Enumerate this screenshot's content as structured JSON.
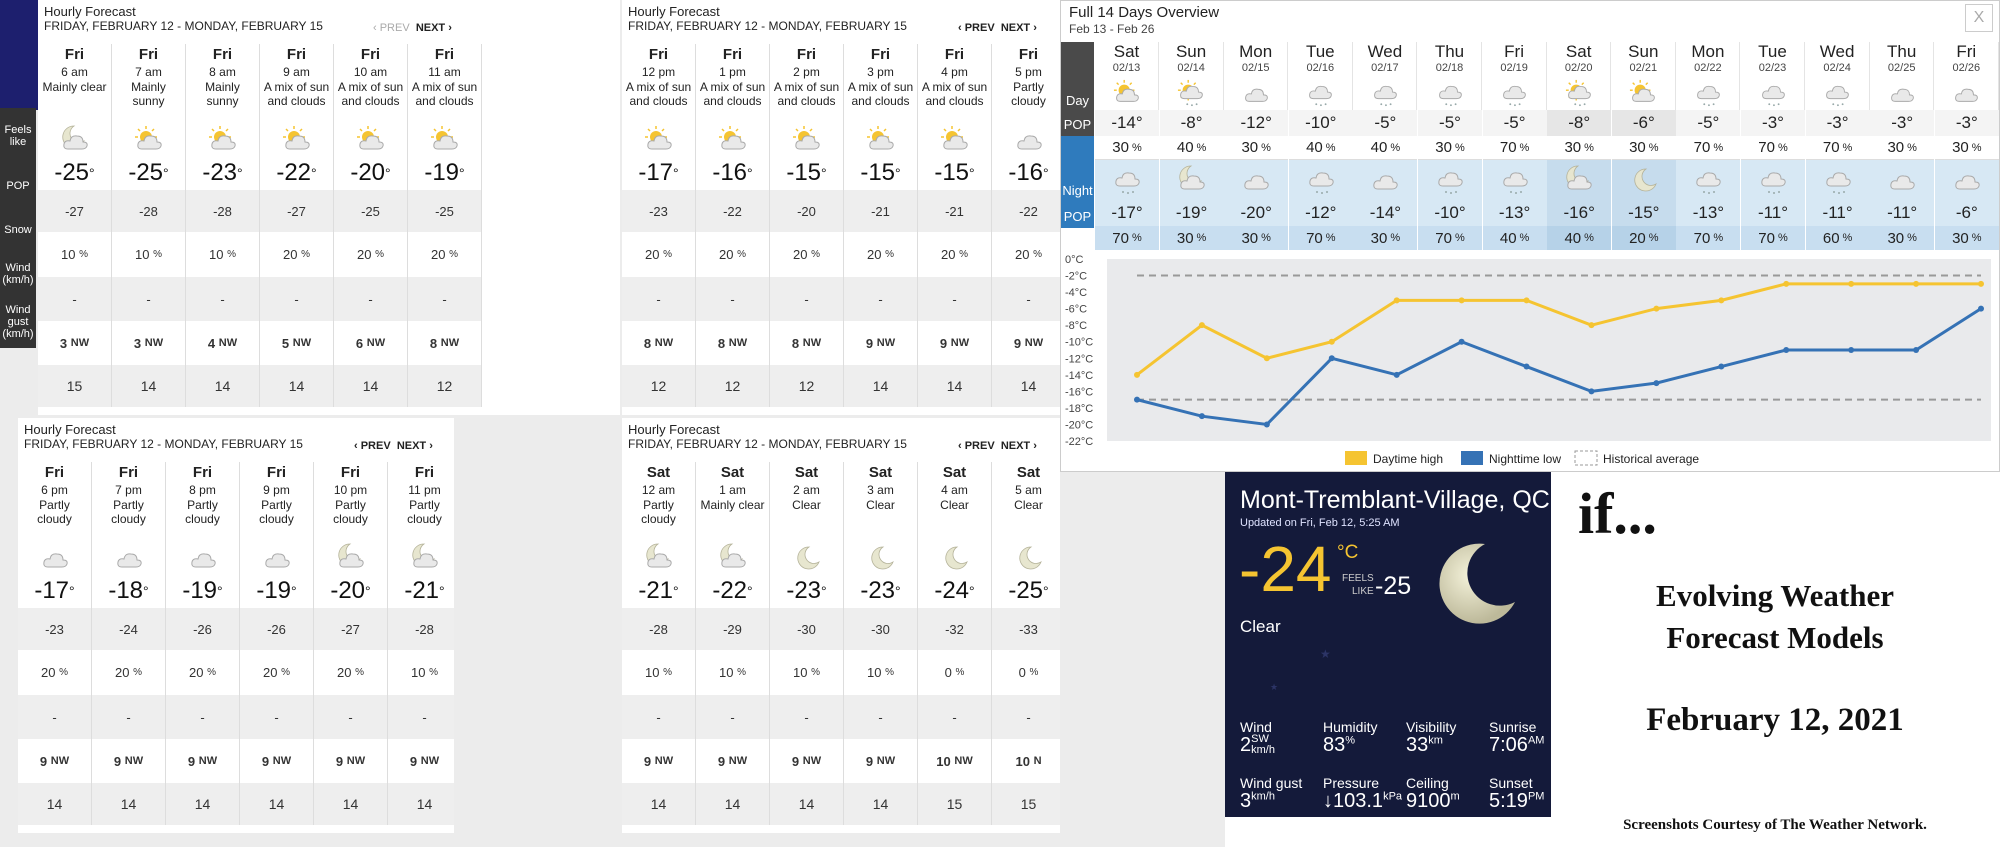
{
  "panel_a": {
    "title": "Hourly Forecast",
    "range": "FRIDAY, FEBRUARY 12 - MONDAY, FEBRUARY 15",
    "prev": "‹ PREV",
    "next": "NEXT ›",
    "row_labels": {
      "feels": "Feels like",
      "pop": "POP",
      "snow": "Snow",
      "wind": "Wind (km/h)",
      "gust": "Wind gust (km/h)"
    },
    "hours": [
      {
        "day": "Fri",
        "time": "6 am",
        "cond": "Mainly clear",
        "icon": "moon-cloud-icon",
        "temp": "-25",
        "feels": "-27",
        "pop": "10",
        "snow": "-",
        "wind": "3",
        "dir": "NW",
        "gust": "15"
      },
      {
        "day": "Fri",
        "time": "7 am",
        "cond": "Mainly sunny",
        "icon": "sun-cloud-icon",
        "temp": "-25",
        "feels": "-28",
        "pop": "10",
        "snow": "-",
        "wind": "3",
        "dir": "NW",
        "gust": "14"
      },
      {
        "day": "Fri",
        "time": "8 am",
        "cond": "Mainly sunny",
        "icon": "sun-cloud-icon",
        "temp": "-23",
        "feels": "-28",
        "pop": "10",
        "snow": "-",
        "wind": "4",
        "dir": "NW",
        "gust": "14"
      },
      {
        "day": "Fri",
        "time": "9 am",
        "cond": "A mix of sun and clouds",
        "icon": "sun-cloud-icon",
        "temp": "-22",
        "feels": "-27",
        "pop": "20",
        "snow": "-",
        "wind": "5",
        "dir": "NW",
        "gust": "14"
      },
      {
        "day": "Fri",
        "time": "10 am",
        "cond": "A mix of sun and clouds",
        "icon": "sun-cloud-icon",
        "temp": "-20",
        "feels": "-25",
        "pop": "20",
        "snow": "-",
        "wind": "6",
        "dir": "NW",
        "gust": "14"
      },
      {
        "day": "Fri",
        "time": "11 am",
        "cond": "A mix of sun and clouds",
        "icon": "sun-cloud-icon",
        "temp": "-19",
        "feels": "-25",
        "pop": "20",
        "snow": "-",
        "wind": "8",
        "dir": "NW",
        "gust": "12"
      }
    ]
  },
  "panel_b": {
    "title": "Hourly Forecast",
    "range": "FRIDAY, FEBRUARY 12 - MONDAY, FEBRUARY 15",
    "prev": "‹ PREV",
    "next": "NEXT ›",
    "hours": [
      {
        "day": "Fri",
        "time": "12 pm",
        "cond": "A mix of sun and clouds",
        "icon": "sun-cloud-icon",
        "temp": "-17",
        "feels": "-23",
        "pop": "20",
        "snow": "-",
        "wind": "8",
        "dir": "NW",
        "gust": "12"
      },
      {
        "day": "Fri",
        "time": "1 pm",
        "cond": "A mix of sun and clouds",
        "icon": "sun-cloud-icon",
        "temp": "-16",
        "feels": "-22",
        "pop": "20",
        "snow": "-",
        "wind": "8",
        "dir": "NW",
        "gust": "12"
      },
      {
        "day": "Fri",
        "time": "2 pm",
        "cond": "A mix of sun and clouds",
        "icon": "sun-cloud-icon",
        "temp": "-15",
        "feels": "-20",
        "pop": "20",
        "snow": "-",
        "wind": "8",
        "dir": "NW",
        "gust": "12"
      },
      {
        "day": "Fri",
        "time": "3 pm",
        "cond": "A mix of sun and clouds",
        "icon": "sun-cloud-icon",
        "temp": "-15",
        "feels": "-21",
        "pop": "20",
        "snow": "-",
        "wind": "9",
        "dir": "NW",
        "gust": "14"
      },
      {
        "day": "Fri",
        "time": "4 pm",
        "cond": "A mix of sun and clouds",
        "icon": "sun-cloud-icon",
        "temp": "-15",
        "feels": "-21",
        "pop": "20",
        "snow": "-",
        "wind": "9",
        "dir": "NW",
        "gust": "14"
      },
      {
        "day": "Fri",
        "time": "5 pm",
        "cond": "Partly cloudy",
        "icon": "cloud-icon",
        "temp": "-16",
        "feels": "-22",
        "pop": "20",
        "snow": "-",
        "wind": "9",
        "dir": "NW",
        "gust": "14"
      }
    ]
  },
  "panel_c": {
    "title": "Hourly Forecast",
    "range": "FRIDAY, FEBRUARY 12 - MONDAY, FEBRUARY 15",
    "prev": "‹ PREV",
    "next": "NEXT ›",
    "hours": [
      {
        "day": "Fri",
        "time": "6 pm",
        "cond": "Partly cloudy",
        "icon": "cloud-icon",
        "temp": "-17",
        "feels": "-23",
        "pop": "20",
        "snow": "-",
        "wind": "9",
        "dir": "NW",
        "gust": "14"
      },
      {
        "day": "Fri",
        "time": "7 pm",
        "cond": "Partly cloudy",
        "icon": "cloud-icon",
        "temp": "-18",
        "feels": "-24",
        "pop": "20",
        "snow": "-",
        "wind": "9",
        "dir": "NW",
        "gust": "14"
      },
      {
        "day": "Fri",
        "time": "8 pm",
        "cond": "Partly cloudy",
        "icon": "cloud-icon",
        "temp": "-19",
        "feels": "-26",
        "pop": "20",
        "snow": "-",
        "wind": "9",
        "dir": "NW",
        "gust": "14"
      },
      {
        "day": "Fri",
        "time": "9 pm",
        "cond": "Partly cloudy",
        "icon": "cloud-icon",
        "temp": "-19",
        "feels": "-26",
        "pop": "20",
        "snow": "-",
        "wind": "9",
        "dir": "NW",
        "gust": "14"
      },
      {
        "day": "Fri",
        "time": "10 pm",
        "cond": "Partly cloudy",
        "icon": "moon-cloud-icon",
        "temp": "-20",
        "feels": "-27",
        "pop": "20",
        "snow": "-",
        "wind": "9",
        "dir": "NW",
        "gust": "14"
      },
      {
        "day": "Fri",
        "time": "11 pm",
        "cond": "Partly cloudy",
        "icon": "moon-cloud-icon",
        "temp": "-21",
        "feels": "-28",
        "pop": "10",
        "snow": "-",
        "wind": "9",
        "dir": "NW",
        "gust": "14"
      }
    ]
  },
  "panel_d": {
    "title": "Hourly Forecast",
    "range": "FRIDAY, FEBRUARY 12 - MONDAY, FEBRUARY 15",
    "prev": "‹ PREV",
    "next": "NEXT ›",
    "hours": [
      {
        "day": "Sat",
        "time": "12 am",
        "cond": "Partly cloudy",
        "icon": "moon-cloud-icon",
        "temp": "-21",
        "feels": "-28",
        "pop": "10",
        "snow": "-",
        "wind": "9",
        "dir": "NW",
        "gust": "14"
      },
      {
        "day": "Sat",
        "time": "1 am",
        "cond": "Mainly clear",
        "icon": "moon-cloud-icon",
        "temp": "-22",
        "feels": "-29",
        "pop": "10",
        "snow": "-",
        "wind": "9",
        "dir": "NW",
        "gust": "14"
      },
      {
        "day": "Sat",
        "time": "2 am",
        "cond": "Clear",
        "icon": "moon-icon",
        "temp": "-23",
        "feels": "-30",
        "pop": "10",
        "snow": "-",
        "wind": "9",
        "dir": "NW",
        "gust": "14"
      },
      {
        "day": "Sat",
        "time": "3 am",
        "cond": "Clear",
        "icon": "moon-icon",
        "temp": "-23",
        "feels": "-30",
        "pop": "10",
        "snow": "-",
        "wind": "9",
        "dir": "NW",
        "gust": "14"
      },
      {
        "day": "Sat",
        "time": "4 am",
        "cond": "Clear",
        "icon": "moon-icon",
        "temp": "-24",
        "feels": "-32",
        "pop": "0",
        "snow": "-",
        "wind": "10",
        "dir": "NW",
        "gust": "15"
      },
      {
        "day": "Sat",
        "time": "5 am",
        "cond": "Clear",
        "icon": "moon-icon",
        "temp": "-25",
        "feels": "-33",
        "pop": "0",
        "snow": "-",
        "wind": "10",
        "dir": "N",
        "gust": "15"
      }
    ]
  },
  "overview": {
    "title": "Full 14 Days Overview",
    "range": "Feb 13 - Feb 26",
    "close": "X",
    "labels": {
      "day": "Day",
      "pop": "POP",
      "night": "Night"
    },
    "days": [
      {
        "dow": "Sat",
        "date": "02/13",
        "day_icon": "sun-cloud-icon",
        "hi": "-14°",
        "day_pop": "30",
        "night_icon": "snow-cloud-icon",
        "lo": "-17°",
        "night_pop": "70"
      },
      {
        "dow": "Sun",
        "date": "02/14",
        "day_icon": "sun-snow-icon",
        "hi": "-8°",
        "day_pop": "40",
        "night_icon": "moon-cloud-icon",
        "lo": "-19°",
        "night_pop": "30"
      },
      {
        "dow": "Mon",
        "date": "02/15",
        "day_icon": "cloud-icon",
        "hi": "-12°",
        "day_pop": "30",
        "night_icon": "cloud-icon",
        "lo": "-20°",
        "night_pop": "30"
      },
      {
        "dow": "Tue",
        "date": "02/16",
        "day_icon": "snow-cloud-icon",
        "hi": "-10°",
        "day_pop": "40",
        "night_icon": "snow-cloud-icon",
        "lo": "-12°",
        "night_pop": "70"
      },
      {
        "dow": "Wed",
        "date": "02/17",
        "day_icon": "snow-cloud-icon",
        "hi": "-5°",
        "day_pop": "40",
        "night_icon": "cloud-icon",
        "lo": "-14°",
        "night_pop": "30"
      },
      {
        "dow": "Thu",
        "date": "02/18",
        "day_icon": "snow-cloud-icon",
        "hi": "-5°",
        "day_pop": "30",
        "night_icon": "snow-cloud-icon",
        "lo": "-10°",
        "night_pop": "70"
      },
      {
        "dow": "Fri",
        "date": "02/19",
        "day_icon": "snow-cloud-icon",
        "hi": "-5°",
        "day_pop": "70",
        "night_icon": "snow-cloud-icon",
        "lo": "-13°",
        "night_pop": "40"
      },
      {
        "dow": "Sat",
        "date": "02/20",
        "day_icon": "sun-snow-icon",
        "hi": "-8°",
        "day_pop": "30",
        "night_icon": "moon-cloud-icon",
        "lo": "-16°",
        "night_pop": "40"
      },
      {
        "dow": "Sun",
        "date": "02/21",
        "day_icon": "sun-cloud-icon",
        "hi": "-6°",
        "day_pop": "30",
        "night_icon": "moon-icon",
        "lo": "-15°",
        "night_pop": "20"
      },
      {
        "dow": "Mon",
        "date": "02/22",
        "day_icon": "snow-cloud-icon",
        "hi": "-5°",
        "day_pop": "70",
        "night_icon": "snow-cloud-icon",
        "lo": "-13°",
        "night_pop": "70"
      },
      {
        "dow": "Tue",
        "date": "02/23",
        "day_icon": "snow-cloud-icon",
        "hi": "-3°",
        "day_pop": "70",
        "night_icon": "snow-cloud-icon",
        "lo": "-11°",
        "night_pop": "70"
      },
      {
        "dow": "Wed",
        "date": "02/24",
        "day_icon": "snow-cloud-icon",
        "hi": "-3°",
        "day_pop": "70",
        "night_icon": "snow-cloud-icon",
        "lo": "-11°",
        "night_pop": "60"
      },
      {
        "dow": "Thu",
        "date": "02/25",
        "day_icon": "cloud-icon",
        "hi": "-3°",
        "day_pop": "30",
        "night_icon": "cloud-icon",
        "lo": "-11°",
        "night_pop": "30"
      },
      {
        "dow": "Fri",
        "date": "02/26",
        "day_icon": "cloud-icon",
        "hi": "-3°",
        "day_pop": "30",
        "night_icon": "cloud-icon",
        "lo": "-6°",
        "night_pop": "30"
      }
    ]
  },
  "chart_data": {
    "type": "line",
    "x": [
      "02/13",
      "02/14",
      "02/15",
      "02/16",
      "02/17",
      "02/18",
      "02/19",
      "02/20",
      "02/21",
      "02/22",
      "02/23",
      "02/24",
      "02/25",
      "02/26"
    ],
    "series": [
      {
        "name": "Daytime high",
        "color": "#f5c431",
        "values": [
          -14,
          -8,
          -12,
          -10,
          -5,
          -5,
          -5,
          -8,
          -6,
          -5,
          -3,
          -3,
          -3,
          -3
        ]
      },
      {
        "name": "Nighttime low",
        "color": "#3572b5",
        "values": [
          -17,
          -19,
          -20,
          -12,
          -14,
          -10,
          -13,
          -16,
          -15,
          -13,
          -11,
          -11,
          -11,
          -6
        ]
      },
      {
        "name": "Historical average",
        "color": "#999999",
        "values": [
          -2,
          -2,
          -2,
          -2,
          -2,
          -2,
          -2,
          -2,
          -2,
          -2,
          -2,
          -2,
          -2,
          -2
        ],
        "values_low": [
          -17,
          -17,
          -17,
          -17,
          -17,
          -17,
          -17,
          -17,
          -17,
          -17,
          -17,
          -17,
          -17,
          -17
        ]
      }
    ],
    "ylim": [
      -22,
      0
    ],
    "yticks": [
      "0°C",
      "-2°C",
      "-4°C",
      "-6°C",
      "-8°C",
      "-10°C",
      "-12°C",
      "-14°C",
      "-16°C",
      "-18°C",
      "-20°C",
      "-22°C"
    ],
    "legend_placement": "bottom"
  },
  "current": {
    "location": "Mont-Tremblant-Village, QC",
    "updated": "Updated on Fri, Feb 12, 5:25 AM",
    "temp": "-24",
    "unit": "°C",
    "feels_label_1": "FEELS",
    "feels_label_2": "LIKE",
    "feels": "-25",
    "condition": "Clear",
    "icon": "moon-icon",
    "wind_label": "Wind",
    "wind_val": "2",
    "wind_dir": "SW",
    "wind_unit": "km/h",
    "humidity_label": "Humidity",
    "humidity_val": "83",
    "humidity_unit": "%",
    "visibility_label": "Visibility",
    "visibility_val": "33",
    "visibility_unit": "km",
    "sunrise_label": "Sunrise",
    "sunrise_val": "7:06",
    "sunrise_unit": "AM",
    "gust_label": "Wind gust",
    "gust_val": "3",
    "gust_unit": "km/h",
    "pressure_label": "Pressure",
    "pressure_val": "↓103.1",
    "pressure_unit": "kPa",
    "ceiling_label": "Ceiling",
    "ceiling_val": "9100",
    "ceiling_unit": "m",
    "sunset_label": "Sunset",
    "sunset_val": "5:19",
    "sunset_unit": "PM"
  },
  "annotation": {
    "if": "if...",
    "title_line1": "Evolving Weather",
    "title_line2": "Forecast Models",
    "date": "February 12, 2021",
    "credit": "Screenshots Courtesy of The Weather Network."
  }
}
